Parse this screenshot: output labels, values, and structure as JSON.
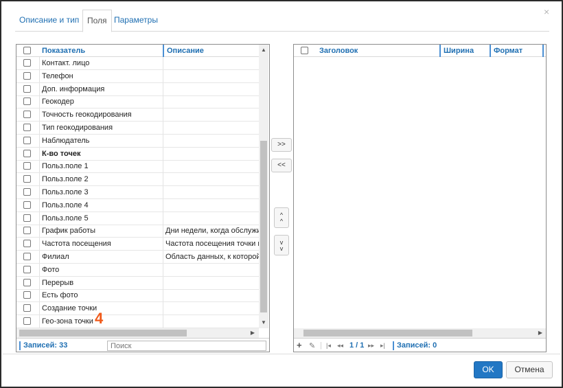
{
  "tabs": [
    {
      "label": "Описание и тип"
    },
    {
      "label": "Поля"
    },
    {
      "label": "Параметры"
    }
  ],
  "left_grid": {
    "headers": {
      "name": "Показатель",
      "description": "Описание"
    },
    "rows": [
      {
        "name": "Контакт. лицо",
        "description": ""
      },
      {
        "name": "Телефон",
        "description": ""
      },
      {
        "name": "Доп. информация",
        "description": ""
      },
      {
        "name": "Геокодер",
        "description": ""
      },
      {
        "name": "Точность геокодирования",
        "description": ""
      },
      {
        "name": "Тип геокодирования",
        "description": ""
      },
      {
        "name": "Наблюдатель",
        "description": ""
      },
      {
        "name": "К-во точек",
        "description": "",
        "bold": true
      },
      {
        "name": "Польз.поле 1",
        "description": ""
      },
      {
        "name": "Польз.поле 2",
        "description": ""
      },
      {
        "name": "Польз.поле 3",
        "description": ""
      },
      {
        "name": "Польз.поле 4",
        "description": ""
      },
      {
        "name": "Польз.поле 5",
        "description": ""
      },
      {
        "name": "График работы",
        "description": "Дни недели, когда обслужива"
      },
      {
        "name": "Частота посещения",
        "description": "Частота посещения точки при"
      },
      {
        "name": "Филиал",
        "description": "Область данных, к которой пр"
      },
      {
        "name": "Фото",
        "description": ""
      },
      {
        "name": "Перерыв",
        "description": ""
      },
      {
        "name": "Есть фото",
        "description": ""
      },
      {
        "name": "Создание точки",
        "description": ""
      },
      {
        "name": "Гео-зона точки",
        "description": ""
      }
    ],
    "records_label": "Записей: 33",
    "search_placeholder": "Поиск"
  },
  "move_buttons": {
    "add": ">>",
    "remove": "<<",
    "up_glyph": "^",
    "down_glyph": "v"
  },
  "right_grid": {
    "headers": {
      "title": "Заголовок",
      "width": "Ширина",
      "format": "Формат"
    },
    "rows": [],
    "pager": {
      "add": "+",
      "edit": "✎",
      "first": "|◂",
      "prev": "◂◂",
      "page": "1 / 1",
      "next": "▸▸",
      "last": "▸|"
    },
    "records_label": "Записей: 0"
  },
  "annotation": "4",
  "buttons": {
    "ok": "OK",
    "cancel": "Отмена",
    "close": "×"
  },
  "colors": {
    "accent": "#2277c4",
    "link": "#1f6fb2",
    "annotation": "#f05a1a"
  }
}
